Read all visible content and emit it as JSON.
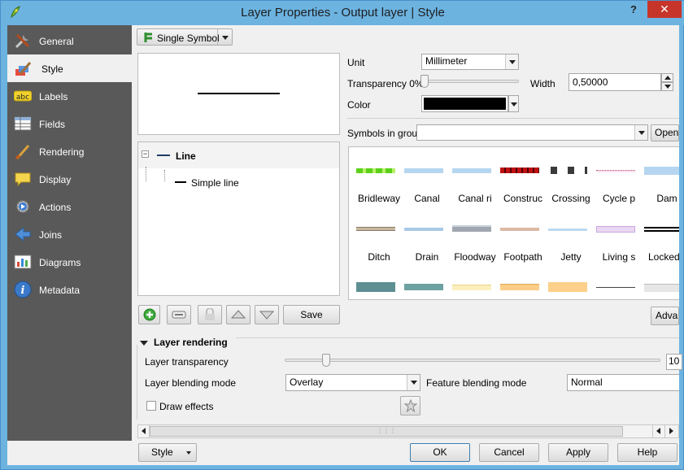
{
  "window": {
    "title": "Layer Properties - Output layer | Style",
    "help_label": "?",
    "close_label": "✕"
  },
  "sidebar": {
    "items": [
      {
        "label": "General",
        "icon": "tools-icon"
      },
      {
        "label": "Style",
        "icon": "paintbrush-icon"
      },
      {
        "label": "Labels",
        "icon": "abc-label-icon"
      },
      {
        "label": "Fields",
        "icon": "table-icon"
      },
      {
        "label": "Rendering",
        "icon": "brush-icon"
      },
      {
        "label": "Display",
        "icon": "speech-bubble-icon"
      },
      {
        "label": "Actions",
        "icon": "gear-action-icon"
      },
      {
        "label": "Joins",
        "icon": "join-arrow-icon"
      },
      {
        "label": "Diagrams",
        "icon": "chart-icon"
      },
      {
        "label": "Metadata",
        "icon": "info-icon"
      }
    ]
  },
  "renderer": {
    "type_label": "Single Symbol"
  },
  "symbol_tree": {
    "root_label": "Line",
    "child_label": "Simple line"
  },
  "symbol_buttons": {
    "save_label": "Save"
  },
  "properties": {
    "unit_label": "Unit",
    "unit_value": "Millimeter",
    "transparency_label": "Transparency 0%",
    "transparency_value": 0,
    "width_label": "Width",
    "width_value": "0,50000",
    "color_label": "Color",
    "color_value": "#000000"
  },
  "symbols_group": {
    "label": "Symbols in group",
    "value": "",
    "open_label": "Open",
    "advanced_label": "Advar",
    "symbols": [
      {
        "name": "Bridleway",
        "style": "bridleway"
      },
      {
        "name": "Canal",
        "style": "canal"
      },
      {
        "name": "Canal ri",
        "style": "canal-ri"
      },
      {
        "name": "Construc",
        "style": "construc"
      },
      {
        "name": "Crossing",
        "style": "crossing"
      },
      {
        "name": "Cycle p",
        "style": "cycle"
      },
      {
        "name": "Dam",
        "style": "dam"
      },
      {
        "name": "Ditch",
        "style": "ditch"
      },
      {
        "name": "Drain",
        "style": "drain"
      },
      {
        "name": "Floodway",
        "style": "floodway"
      },
      {
        "name": "Footpath",
        "style": "footpath"
      },
      {
        "name": "Jetty",
        "style": "jetty"
      },
      {
        "name": "Living s",
        "style": "living"
      },
      {
        "name": "LockedF",
        "style": "locked"
      },
      {
        "name": "",
        "style": "teal"
      },
      {
        "name": "",
        "style": "teal2"
      },
      {
        "name": "",
        "style": "cream"
      },
      {
        "name": "",
        "style": "orange"
      },
      {
        "name": "",
        "style": "orange2"
      },
      {
        "name": "",
        "style": "thinline"
      },
      {
        "name": "",
        "style": "grey"
      }
    ]
  },
  "layer_rendering": {
    "header": "Layer rendering",
    "transparency_label": "Layer transparency",
    "transparency_value": 10,
    "transparency_display": "10",
    "blending_label": "Layer blending mode",
    "blending_value": "Overlay",
    "feature_blending_label": "Feature blending mode",
    "feature_blending_value": "Normal",
    "draw_effects_label": "Draw effects",
    "draw_effects_checked": false
  },
  "footer": {
    "style_label": "Style",
    "ok_label": "OK",
    "cancel_label": "Cancel",
    "apply_label": "Apply",
    "help_label": "Help"
  }
}
